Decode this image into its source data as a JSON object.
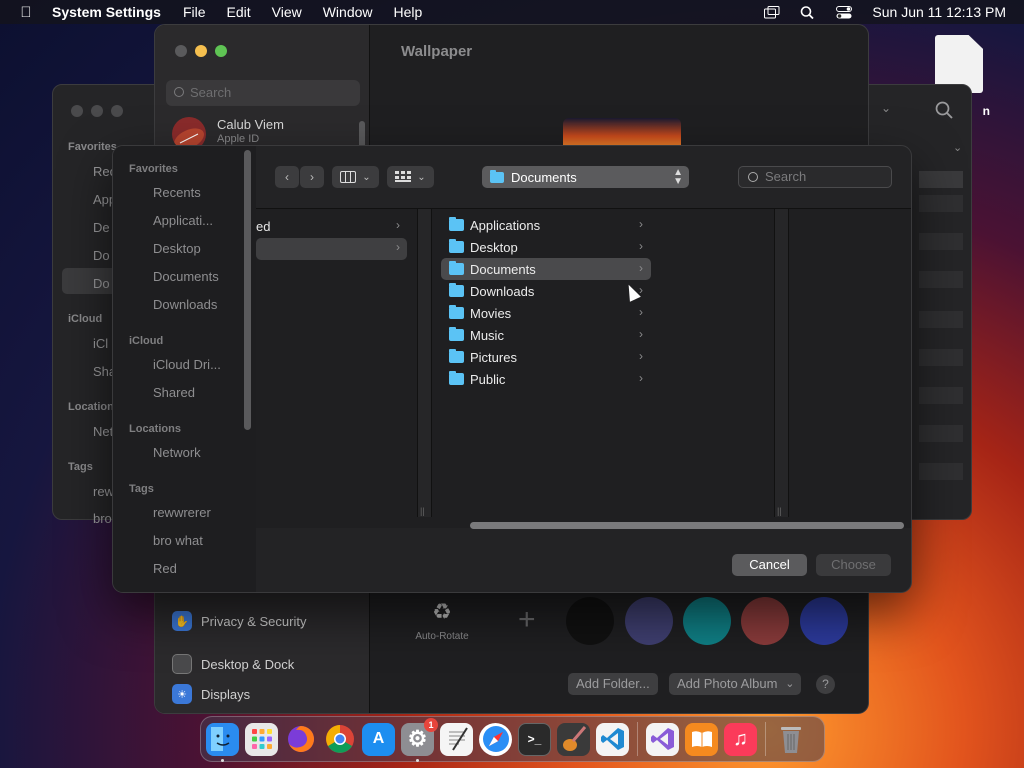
{
  "menubar": {
    "app_name": "System Settings",
    "menus": [
      "File",
      "Edit",
      "View",
      "Window",
      "Help"
    ],
    "clock": "Sun Jun 11  12:13 PM"
  },
  "desktop": {
    "doc_label": "n"
  },
  "finder_bg": {
    "favorites_header": "Favorites",
    "icloud_header": "iCloud",
    "locations_header": "Locations",
    "tags_header": "Tags",
    "items": [
      "Rec",
      "App",
      "De",
      "Do",
      "Do",
      "iCl",
      "Sha",
      "Net",
      "rew",
      "bro"
    ]
  },
  "settings": {
    "title": "Wallpaper",
    "search_placeholder": "Search",
    "profile_name": "Calub Viem",
    "profile_sub": "Apple ID",
    "sidebar_items": [
      {
        "label": "Privacy & Security",
        "color": "#3b78d8"
      },
      {
        "label": "Desktop & Dock",
        "color": "#4a4a4c"
      },
      {
        "label": "Displays",
        "color": "#3b78d8"
      }
    ],
    "autorotate_label": "Auto-Rotate",
    "add_folder": "Add Folder...",
    "add_album": "Add Photo Album",
    "help": "?",
    "swatches": [
      "#111111",
      "#3f3f70",
      "#0f7f85",
      "#8a3b3b",
      "#2c3a9c"
    ]
  },
  "dialog": {
    "sidebar": {
      "favorites_header": "Favorites",
      "favorites": [
        "Recents",
        "Applicati...",
        "Desktop",
        "Documents",
        "Downloads"
      ],
      "icloud_header": "iCloud",
      "icloud": [
        "iCloud Dri...",
        "Shared"
      ],
      "locations_header": "Locations",
      "locations": [
        "Network"
      ],
      "tags_header": "Tags",
      "tags": [
        "rewwrerer",
        "bro what",
        "Red"
      ]
    },
    "path_location": "Documents",
    "search_placeholder": "Search",
    "prev_column_text": "ed",
    "folders": [
      {
        "name": "Applications"
      },
      {
        "name": "Desktop"
      },
      {
        "name": "Documents",
        "selected": true
      },
      {
        "name": "Downloads"
      },
      {
        "name": "Movies"
      },
      {
        "name": "Music"
      },
      {
        "name": "Pictures"
      },
      {
        "name": "Public"
      }
    ],
    "cancel_label": "Cancel",
    "choose_label": "Choose"
  },
  "dock": {
    "apps": [
      {
        "name": "finder-icon",
        "color": "#2a8cf0",
        "running": true,
        "glyph": ""
      },
      {
        "name": "launchpad-icon",
        "color": "#e8e8e8",
        "running": false,
        "glyph": ""
      },
      {
        "name": "firefox-icon",
        "color": "#ff6b1a",
        "running": false,
        "glyph": ""
      },
      {
        "name": "chrome-icon",
        "color": "#f2f2f2",
        "running": false,
        "glyph": ""
      },
      {
        "name": "app-store-icon",
        "color": "#1d8ef0",
        "running": false,
        "glyph": "A"
      },
      {
        "name": "system-settings-icon",
        "color": "#8e8e93",
        "running": true,
        "glyph": "⚙",
        "badge": "1"
      },
      {
        "name": "textedit-icon",
        "color": "#f5f5f5",
        "running": false,
        "glyph": ""
      },
      {
        "name": "safari-icon",
        "color": "#2b8ef5",
        "running": false,
        "glyph": ""
      },
      {
        "name": "terminal-icon",
        "color": "#2a2a2a",
        "running": false,
        "glyph": ">_"
      },
      {
        "name": "garageband-icon",
        "color": "#3a3a3a",
        "running": false,
        "glyph": "♪"
      },
      {
        "name": "vscode-icon",
        "color": "#f4f4f4",
        "running": false,
        "glyph": ""
      },
      {
        "name": "visual-studio-icon",
        "color": "#f4f4f4",
        "running": false,
        "glyph": ""
      },
      {
        "name": "books-icon",
        "color": "#f58a1f",
        "running": false,
        "glyph": ""
      },
      {
        "name": "music-icon",
        "color": "#fb3b5a",
        "running": false,
        "glyph": "♫"
      },
      {
        "name": "trash-icon",
        "color": "transparent",
        "running": false,
        "glyph": ""
      }
    ]
  }
}
